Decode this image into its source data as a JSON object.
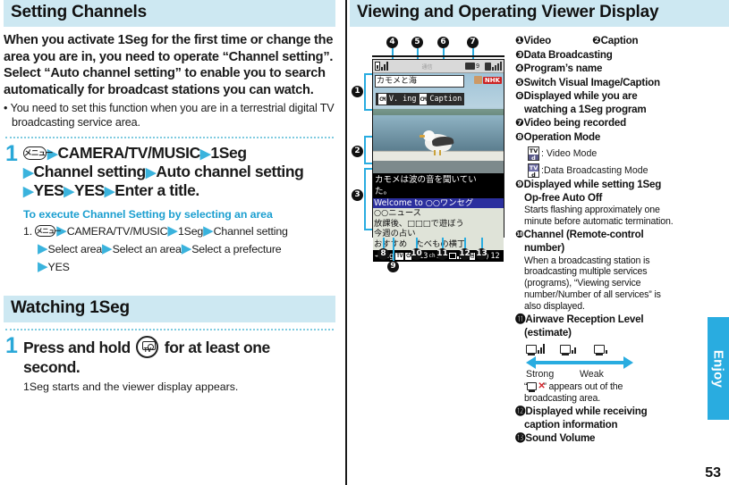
{
  "left": {
    "section1_title": "Setting Channels",
    "intro": "When you activate 1Seg for the first time or change the area you are in, you need to operate “Channel setting”. Select “Auto channel setting” to enable you to search automatically for broadcast stations you can watch.",
    "bullet": "You need to set this function when you are in a terrestrial digital TV broadcasting service area.",
    "step1": {
      "number": "1",
      "key": "menu-key",
      "line1_a": "CAMERA/TV/MUSIC",
      "line1_b": "1Seg",
      "line2_a": "Channel setting",
      "line2_b": "Auto channel setting",
      "line3_a": "YES",
      "line3_b": "YES",
      "line3_c": "Enter a title."
    },
    "sub": {
      "heading": "To execute Channel Setting by selecting an area",
      "num": "1.",
      "l1_a": "CAMERA/TV/MUSIC",
      "l1_b": "1Seg",
      "l1_c": "Channel setting",
      "l2_a": "Select area",
      "l2_b": "Select an area",
      "l2_c": "Select a prefecture",
      "l3_a": "YES"
    },
    "section2_title": "Watching 1Seg",
    "step2": {
      "number": "1",
      "text_a": "Press and hold",
      "key": "camera-tv-key",
      "text_b": "for at least one",
      "text_c": "second."
    },
    "step2_note": "1Seg starts and the viewer display appears."
  },
  "right": {
    "section_title": "Viewing and Operating Viewer Display",
    "phone": {
      "status_center": "通信",
      "rec_label": "9",
      "program_title": "カモメと海",
      "station_logo": "NHK",
      "badge1_chip": "CM",
      "badge1_text": "V. ing",
      "badge2_chip": "CM",
      "badge2_text": "Caption",
      "caption_line1": "カモメは波の音を聞いてい",
      "caption_line2": "た。",
      "data_rows": [
        "Welcome to ○○ワンセグ",
        "○○ニュース",
        "放課後、□□□で遊ぼう",
        "今週の占い",
        "おすすめ　たべもの横丁"
      ],
      "bottom_chg": "Chg",
      "bottom_channel": "13",
      "bottom_channel_sup": "ch",
      "bottom_service": "1/3",
      "bottom_volume": "12"
    },
    "callouts": [
      "1",
      "2",
      "3",
      "4",
      "5",
      "6",
      "7",
      "8",
      "9",
      "10",
      "11",
      "12",
      "13"
    ],
    "legend": {
      "i1": "Video",
      "i2": "Caption",
      "i3": "Data Broadcasting",
      "i4": "Program’s name",
      "i5": "Switch Visual Image/Caption",
      "i6_l1": "Displayed while you are",
      "i6_l2": "watching a 1Seg program",
      "i7": "Video being recorded",
      "i8": "Operation Mode",
      "i8_mode1": ": Video Mode",
      "i8_mode2": ":Data Broadcasting Mode",
      "i9_l1": "Displayed while setting 1Seg",
      "i9_l2": "Op-free Auto Off",
      "i9_note": "Starts flashing approximately one minute before automatic termination.",
      "i10_l1": "Channel (Remote-control",
      "i10_l2": "number)",
      "i10_note": "When a broadcasting station is broadcasting multiple services (programs), “Viewing service number/Number of all services” is also displayed.",
      "i11_l1": "Airwave Reception Level",
      "i11_l2": "(estimate)",
      "i11_strong": "Strong",
      "i11_weak": "Weak",
      "i11_note_a": "“",
      "i11_note_b": "” appears out of the",
      "i11_note_c": "broadcasting area.",
      "i12_l1": "Displayed while receiving",
      "i12_l2": "caption information",
      "i13": "Sound Volume"
    },
    "side_tab": "Enjoy",
    "page_number": "53"
  },
  "icons": {
    "menu_key": "⌨",
    "triangle": "▶",
    "tv_label": "TV",
    "d_label": "d"
  },
  "colors": {
    "header_bg": "#cde8f2",
    "accent": "#29ace0",
    "accent_text": "#1c9fd0",
    "callout_bg": "#111111"
  }
}
